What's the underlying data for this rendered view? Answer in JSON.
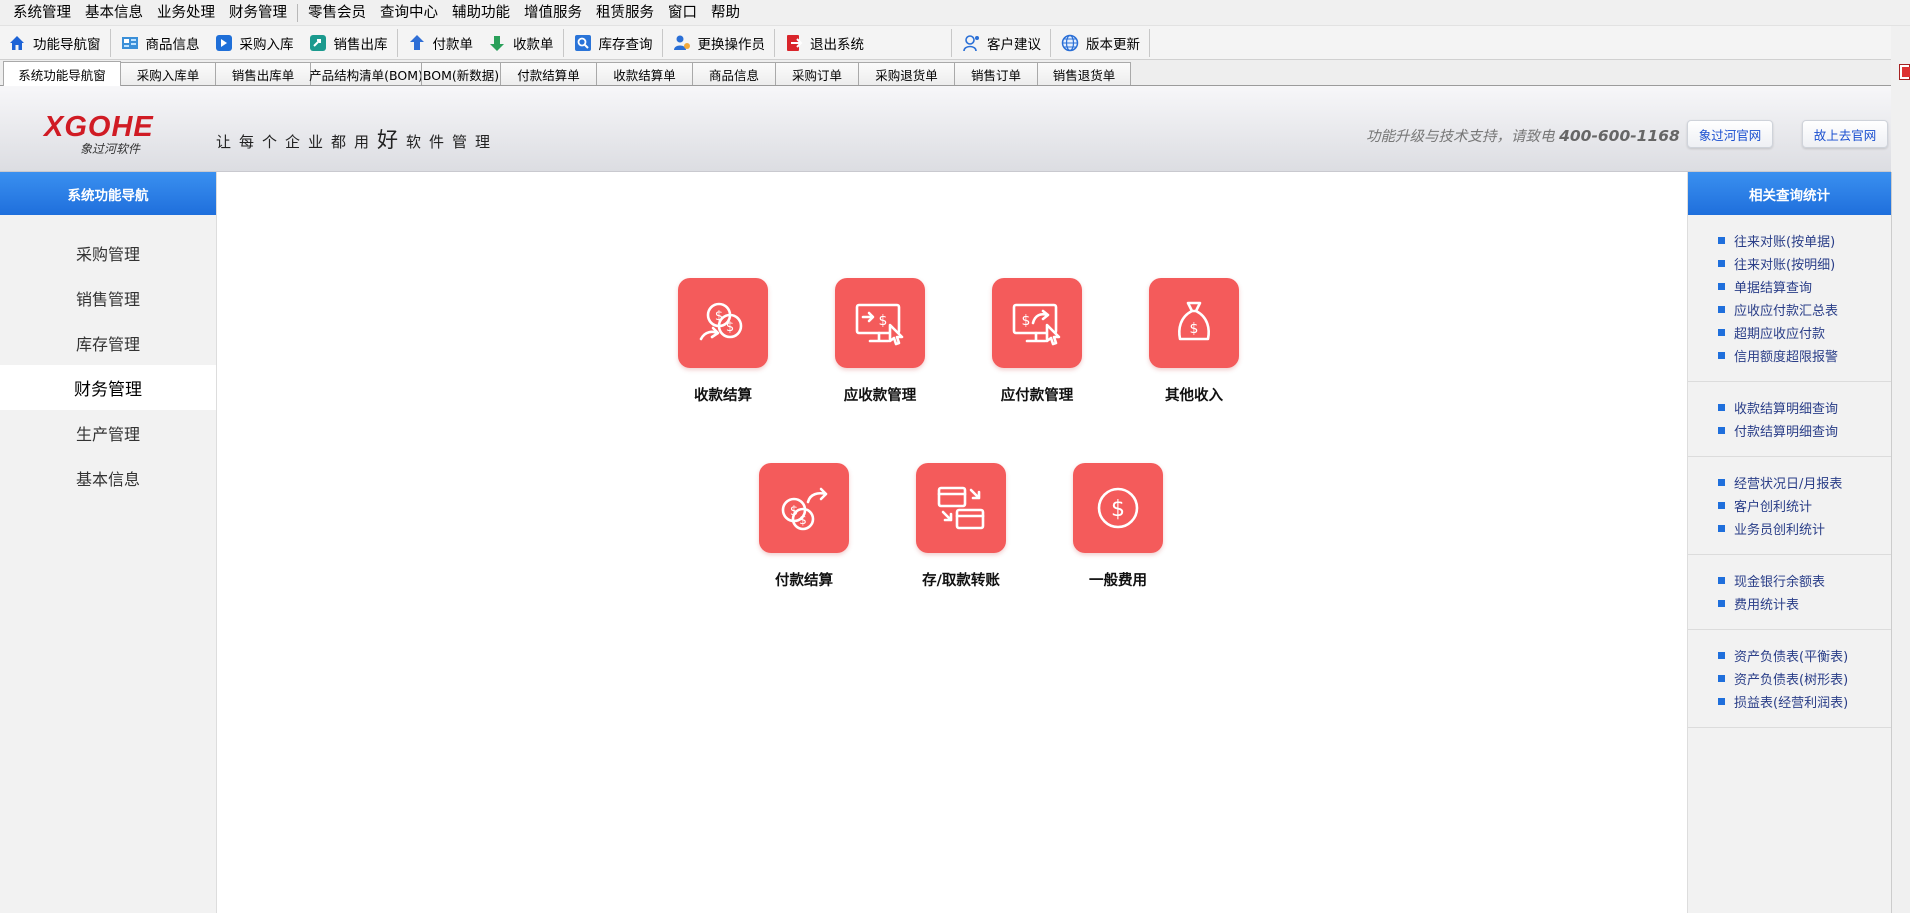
{
  "menubar": {
    "items": [
      "系统管理",
      "基本信息",
      "业务处理",
      "财务管理",
      "零售会员",
      "查询中心",
      "辅助功能",
      "增值服务",
      "租赁服务",
      "窗口",
      "帮助"
    ]
  },
  "toolbar": {
    "items": [
      {
        "label": "功能导航窗",
        "icon": "home-icon"
      },
      {
        "label": "商品信息",
        "icon": "product-info-icon"
      },
      {
        "label": "采购入库",
        "icon": "purchase-in-icon"
      },
      {
        "label": "销售出库",
        "icon": "sales-out-icon"
      },
      {
        "label": "付款单",
        "icon": "payment-icon"
      },
      {
        "label": "收款单",
        "icon": "receipt-icon"
      },
      {
        "label": "库存查询",
        "icon": "search-icon"
      },
      {
        "label": "更换操作员",
        "icon": "user-switch-icon"
      },
      {
        "label": "退出系统",
        "icon": "exit-icon"
      },
      {
        "label": "客户建议",
        "icon": "feedback-icon"
      },
      {
        "label": "版本更新",
        "icon": "globe-icon"
      }
    ]
  },
  "tabs": [
    {
      "label": "系统功能导航窗"
    },
    {
      "label": "采购入库单"
    },
    {
      "label": "销售出库单"
    },
    {
      "label": "产品结构清单(BOM)"
    },
    {
      "label": "BOM(新数据)"
    },
    {
      "label": "付款结算单"
    },
    {
      "label": "收款结算单"
    },
    {
      "label": "商品信息"
    },
    {
      "label": "采购订单"
    },
    {
      "label": "采购退货单"
    },
    {
      "label": "销售订单"
    },
    {
      "label": "销售退货单"
    }
  ],
  "banner": {
    "logo_text": "XGOHE",
    "logo_sub": "象过河软件",
    "slogan_a": "让每个企业都用",
    "slogan_b": "好",
    "slogan_c": "软件管理",
    "support_text": "功能升级与技术支持，请致电 ",
    "support_phone": "400-600-1168",
    "btn_official": "象过河官网",
    "btn_online": "故上去官网"
  },
  "leftnav": {
    "title": "系统功能导航",
    "items": [
      "采购管理",
      "销售管理",
      "库存管理",
      "财务管理",
      "生产管理",
      "基本信息"
    ],
    "active_index": 3
  },
  "functions": [
    {
      "label": "收款结算",
      "icon": "coins-in-icon"
    },
    {
      "label": "应收款管理",
      "icon": "receivable-monitor-icon"
    },
    {
      "label": "应付款管理",
      "icon": "payable-monitor-icon"
    },
    {
      "label": "其他收入",
      "icon": "money-bag-icon"
    },
    {
      "label": "付款结算",
      "icon": "coins-out-icon"
    },
    {
      "label": "存/取款转账",
      "icon": "transfer-cards-icon"
    },
    {
      "label": "一般费用",
      "icon": "dollar-circle-icon"
    }
  ],
  "rightpanel": {
    "title": "相关查询统计",
    "groups": [
      [
        "往来对账(按单据)",
        "往来对账(按明细)",
        "单据结算查询",
        "应收应付款汇总表",
        "超期应收应付款",
        "信用额度超限报警"
      ],
      [
        "收款结算明细查询",
        "付款结算明细查询"
      ],
      [
        "经营状况日/月报表",
        "客户创利统计",
        "业务员创利统计"
      ],
      [
        "现金银行余额表",
        "费用统计表"
      ],
      [
        "资产负债表(平衡表)",
        "资产负债表(树形表)",
        "损益表(经营利润表)"
      ]
    ]
  },
  "colors": {
    "tile": "#f45b5b",
    "panel_head": "#1f6fdc",
    "logo": "#d01b24",
    "link": "#2a3e88"
  }
}
